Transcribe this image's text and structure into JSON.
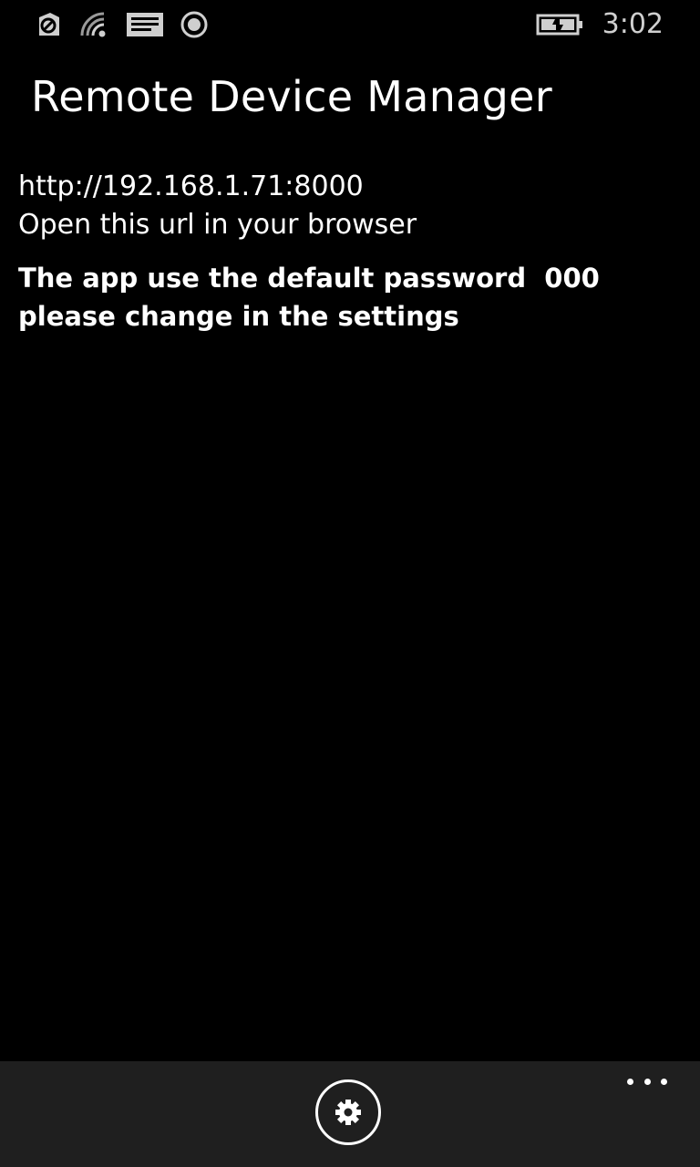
{
  "status_bar": {
    "icons": [
      "data-sense-icon",
      "wifi-icon",
      "message-icon",
      "location-icon",
      "battery-charging-icon"
    ],
    "time": "3:02"
  },
  "app": {
    "title": "Remote Device Manager"
  },
  "main": {
    "url": "http://192.168.1.71:8000",
    "hint": "Open this url in your browser",
    "warning": "The app use the default password  000  please change in the settings"
  },
  "app_bar": {
    "buttons": [
      "settings-icon"
    ],
    "more": "more-options-icon"
  },
  "colors": {
    "background": "#000000",
    "app_bar": "#1f1f1f",
    "text": "#ffffff",
    "status": "#cfcfcf"
  }
}
